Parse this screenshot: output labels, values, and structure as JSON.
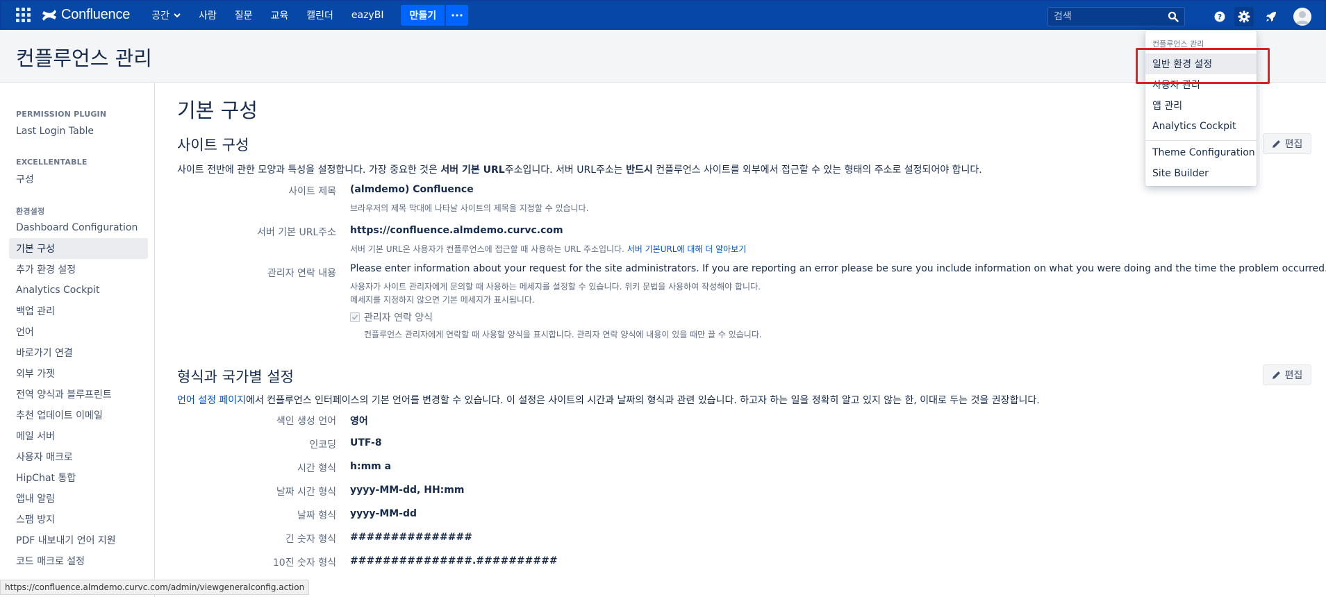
{
  "topbar": {
    "logo_text": "Confluence",
    "nav": [
      {
        "label": "공간",
        "has_chevron": true
      },
      {
        "label": "사람"
      },
      {
        "label": "질문"
      },
      {
        "label": "교육"
      },
      {
        "label": "캘린더"
      },
      {
        "label": "eazyBI"
      }
    ],
    "create_label": "만들기",
    "more_label": "•••",
    "search_placeholder": "검색",
    "brand_color": "#0747a6",
    "create_color": "#0065ff",
    "icons": [
      "apps-grid-icon",
      "search-icon",
      "help-icon",
      "gear-icon",
      "rocket-icon",
      "avatar-icon"
    ]
  },
  "page_header": {
    "title": "컨플루언스 관리"
  },
  "sidebar": {
    "sections": [
      {
        "heading": "PERMISSION PLUGIN",
        "items": [
          "Last Login Table"
        ]
      },
      {
        "heading": "EXCELLENTABLE",
        "items": [
          "구성"
        ]
      },
      {
        "heading": "환경설정",
        "items": [
          "Dashboard Configuration",
          "기본 구성",
          "추가 환경 설정",
          "Analytics Cockpit",
          "백업 관리",
          "언어",
          "바로가기 연결",
          "외부 가젯",
          "전역 양식과 블루프린트",
          "추천 업데이트 이메일",
          "메일 서버",
          "사용자 매크로",
          "HipChat 통합",
          "앱내 알림",
          "스팸 방지",
          "PDF 내보내기 언어 지원",
          "코드 매크로 설정"
        ]
      }
    ],
    "active_item": "기본 구성"
  },
  "main": {
    "title": "기본 구성",
    "edit_label": "편집",
    "site_config": {
      "title": "사이트 구성",
      "desc_1": "사이트 전반에 관한 모양과 특성을 설정합니다. 가장 중요한 것은 ",
      "desc_bold_1": "서버 기본 URL",
      "desc_2": "주소입니다. 서버 URL주소는 ",
      "desc_bold_2": "반드시",
      "desc_3": " 컨플루언스 사이트를 외부에서 접근할 수 있는 형태의 주소로 설정되어야 합니다.",
      "rows": {
        "site_title_label": "사이트 제목",
        "site_title_value": "(almdemo) Confluence",
        "site_title_hint": "브라우저의 제목 막대에 나타날 사이트의 제목을 지정할 수 있습니다.",
        "base_url_label": "서버 기본 URL주소",
        "base_url_value": "https://confluence.almdemo.curvc.com",
        "base_url_hint": "서버 기본 URL은 사용자가 컨플루언스에 접근할 때 사용하는 URL 주소입니다. ",
        "base_url_link": "서버 기본URL에 대해 더 알아보기",
        "admin_contact_label": "관리자 연락 내용",
        "admin_contact_value": "Please enter information about your request for the site administrators. If you are reporting an error please be sure you include information on what you were doing and the time the problem occurred.",
        "admin_contact_hint_1": "사용자가 사이트 관리자에게 문의할 때 사용하는 메세지를 설정할 수 있습니다. 위키 문법을 사용하여 작성해야 합니다.",
        "admin_contact_hint_2": "메세지를 지정하지 않으면 기본 메세지가 표시됩니다.",
        "contact_form_label": "관리자 연락 양식",
        "contact_form_checked": true,
        "contact_form_hint": "컨플루언스 관리자에게 연락할 때 사용할 양식을 표시합니다. 관리자 연락 양식에 내용이 있을 때만 끌 수 있습니다."
      }
    },
    "locale_config": {
      "title": "형식과 국가별 설정",
      "desc_link": "언어 설정 페이지",
      "desc_rest": "에서 컨플루언스 인터페이스의 기본 언어를 변경할 수 있습니다. 이 설정은 사이트의 시간과 날짜의 형식과 관련 있습니다. 하고자 하는 일을 정확히 알고 있지 않는 한, 이대로 두는 것을 권장합니다.",
      "rows": [
        {
          "label": "색인 생성 언어",
          "value": "영어"
        },
        {
          "label": "인코딩",
          "value": "UTF-8"
        },
        {
          "label": "시간 형식",
          "value": "h:mm a"
        },
        {
          "label": "날짜 시간 형식",
          "value": "yyyy-MM-dd, HH:mm"
        },
        {
          "label": "날짜 형식",
          "value": "yyyy-MM-dd"
        },
        {
          "label": "긴 숫자 형식",
          "value": "###############"
        },
        {
          "label": "10진 숫자 형식",
          "value": "###############.##########"
        }
      ]
    }
  },
  "dropdown": {
    "heading": "컨플루언스 관리",
    "items": [
      "일반 환경 설정",
      "사용자 관리",
      "앱 관리",
      "Analytics Cockpit"
    ],
    "items_2": [
      "Theme Configuration",
      "Site Builder"
    ],
    "highlight_color": "#e02020"
  },
  "statusbar": {
    "url": "https://confluence.almdemo.curvc.com/admin/viewgeneralconfig.action"
  }
}
